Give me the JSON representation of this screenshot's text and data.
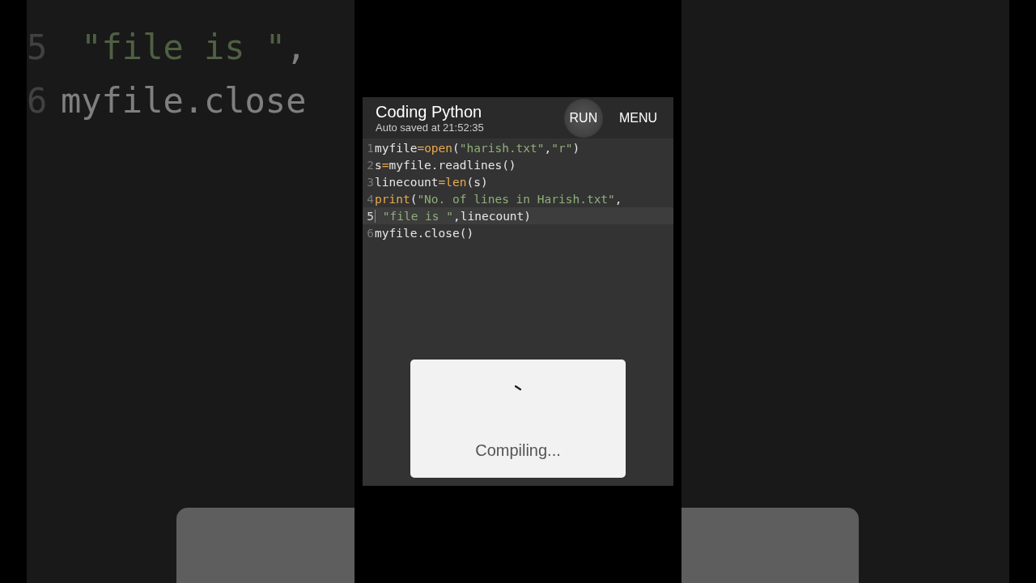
{
  "backdrop": {
    "lines": [
      {
        "number": "5",
        "code": [
          {
            "kind": "string",
            "text": " \"file is \""
          },
          {
            "kind": "plain",
            "text": ","
          }
        ]
      },
      {
        "number": "6",
        "code": [
          {
            "kind": "plain",
            "text": "myfile.close"
          }
        ]
      }
    ]
  },
  "app_bar": {
    "title": "Coding Python",
    "subtitle": "Auto saved at 21:52:35",
    "actions": [
      {
        "label": "RUN",
        "pressed": true
      },
      {
        "label": "MENU",
        "pressed": false
      }
    ]
  },
  "editor": {
    "lines": [
      {
        "number": "1",
        "current": false,
        "code": [
          {
            "kind": "plain",
            "text": "myfile"
          },
          {
            "kind": "operator",
            "text": "="
          },
          {
            "kind": "keyword",
            "text": "open"
          },
          {
            "kind": "plain",
            "text": "("
          },
          {
            "kind": "string",
            "text": "\"harish.txt\""
          },
          {
            "kind": "plain",
            "text": ","
          },
          {
            "kind": "string",
            "text": "\"r\""
          },
          {
            "kind": "plain",
            "text": ")"
          }
        ]
      },
      {
        "number": "2",
        "current": false,
        "code": [
          {
            "kind": "plain",
            "text": "s"
          },
          {
            "kind": "operator",
            "text": "="
          },
          {
            "kind": "plain",
            "text": "myfile.readlines()"
          }
        ]
      },
      {
        "number": "3",
        "current": false,
        "code": [
          {
            "kind": "plain",
            "text": "linecount"
          },
          {
            "kind": "operator",
            "text": "="
          },
          {
            "kind": "keyword",
            "text": "len"
          },
          {
            "kind": "plain",
            "text": "(s)"
          }
        ]
      },
      {
        "number": "4",
        "current": false,
        "code": [
          {
            "kind": "keyword",
            "text": "print"
          },
          {
            "kind": "plain",
            "text": "("
          },
          {
            "kind": "string",
            "text": "\"No. of lines in Harish.txt\""
          },
          {
            "kind": "plain",
            "text": ","
          }
        ]
      },
      {
        "number": "5",
        "current": true,
        "code": [
          {
            "kind": "string",
            "text": " \"file is \""
          },
          {
            "kind": "plain",
            "text": ",linecount)"
          }
        ]
      },
      {
        "number": "6",
        "current": false,
        "code": [
          {
            "kind": "plain",
            "text": "myfile.close()"
          }
        ]
      }
    ]
  },
  "dialog": {
    "message": "Compiling..."
  }
}
